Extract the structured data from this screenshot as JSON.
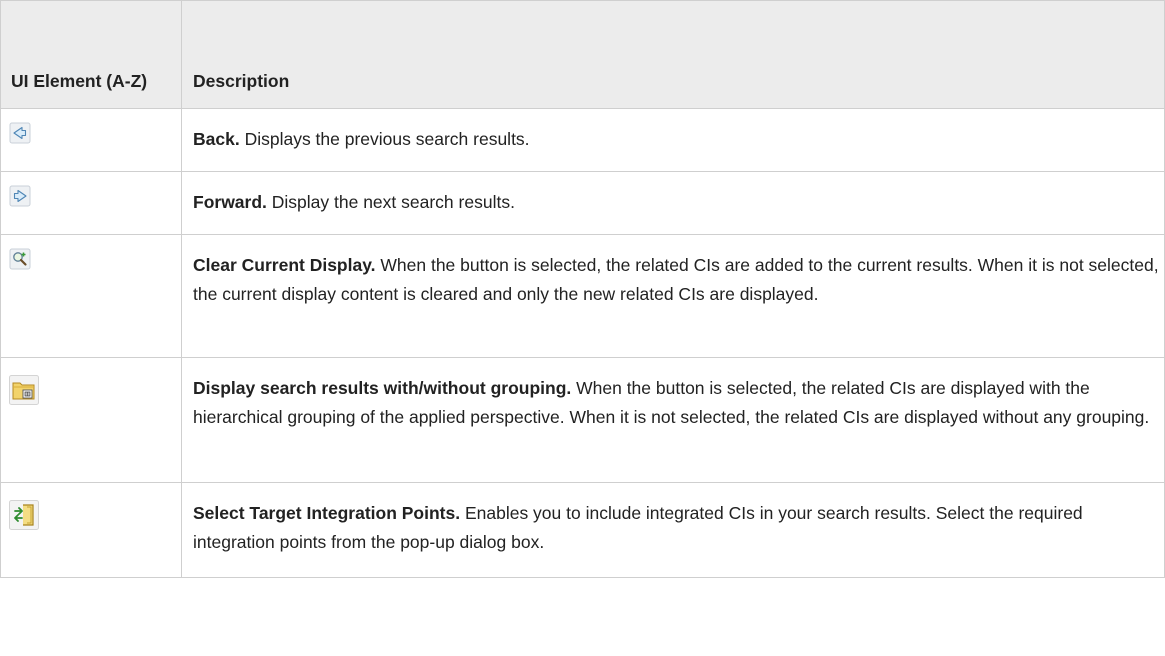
{
  "table": {
    "headers": {
      "ui_element": "UI Element (A-Z)",
      "description": "Description"
    },
    "rows": [
      {
        "icon": "back-arrow-icon",
        "term": "Back.",
        "text": " Displays the previous search results."
      },
      {
        "icon": "forward-arrow-icon",
        "term": "Forward.",
        "text": " Display the next search results."
      },
      {
        "icon": "clear-display-magnifier-icon",
        "term": "Clear Current Display.",
        "text": " When the button is selected, the related CIs are added to the current results. When it is not selected, the current display content is cleared and only the new related CIs are displayed."
      },
      {
        "icon": "folder-grouping-icon",
        "term": "Display search results with/without grouping.",
        "text": " When the button is selected, the related CIs are displayed with the hierarchical grouping of the applied perspective. When it is not selected, the related CIs are displayed without any grouping."
      },
      {
        "icon": "integration-points-icon",
        "term": "Select Target Integration Points.",
        "text": " Enables you to include integrated CIs in your search results. Select the required integration points from the pop-up dialog box."
      }
    ]
  },
  "colors": {
    "header_bg": "#ececec",
    "border": "#cfcfcf",
    "text": "#222222"
  }
}
